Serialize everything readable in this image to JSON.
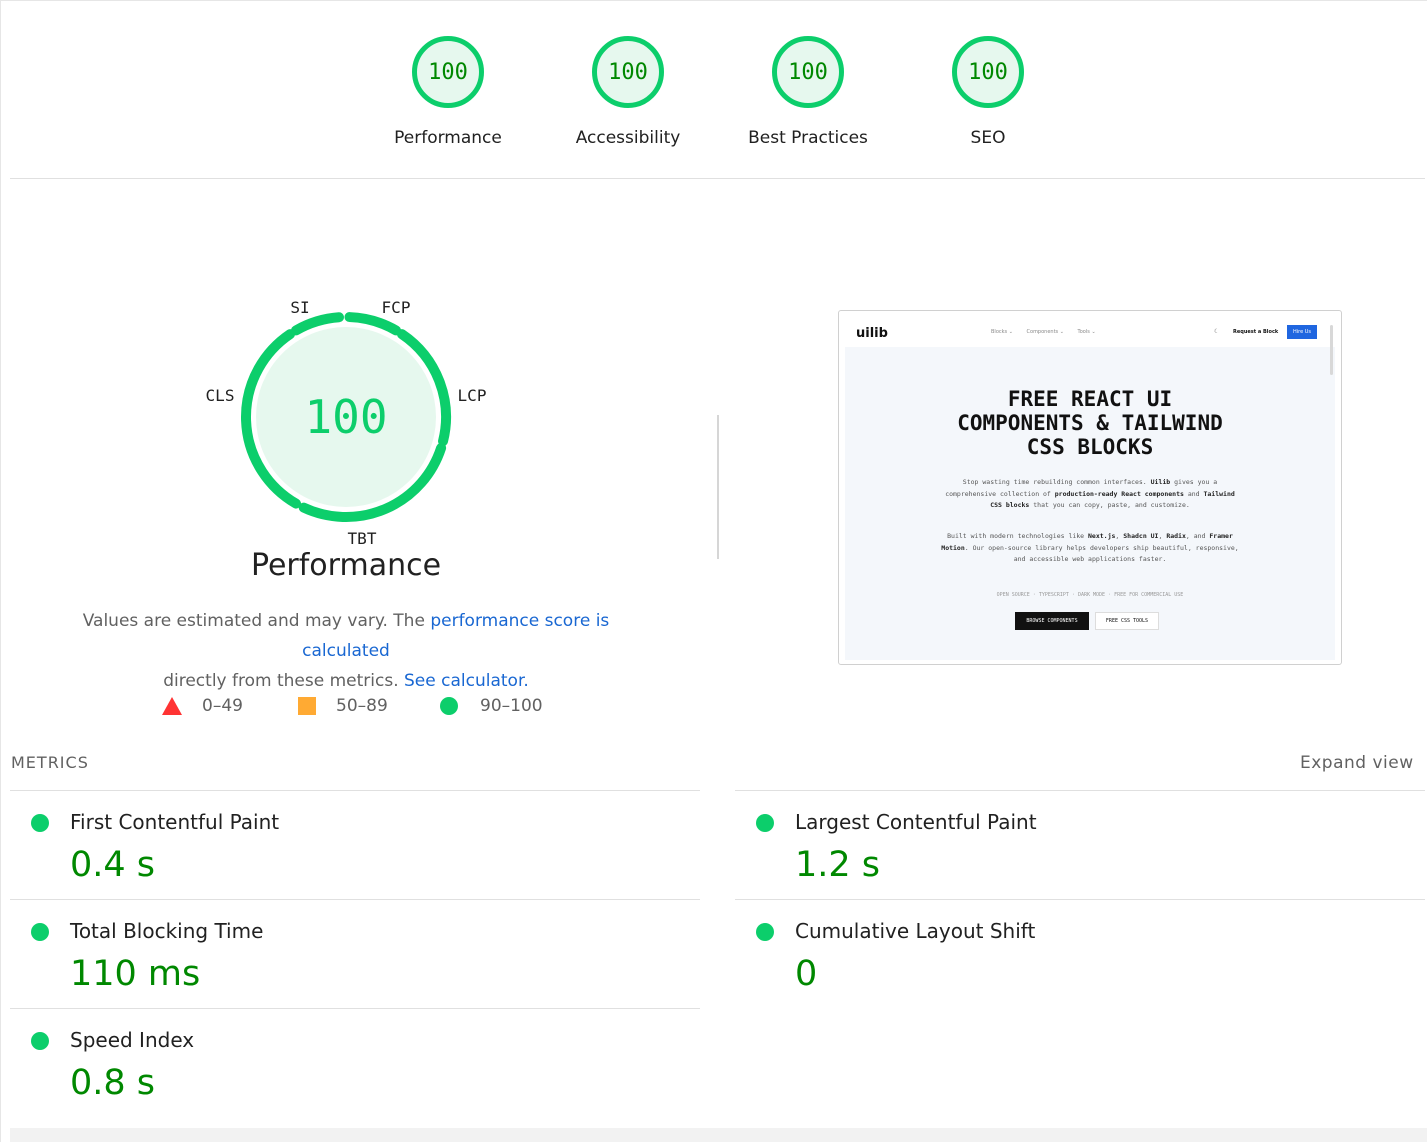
{
  "categories": [
    {
      "label": "Performance",
      "score": "100"
    },
    {
      "label": "Accessibility",
      "score": "100"
    },
    {
      "label": "Best Practices",
      "score": "100"
    },
    {
      "label": "SEO",
      "score": "100"
    }
  ],
  "gauge": {
    "score": "100",
    "title": "Performance",
    "labels": {
      "si": "SI",
      "fcp": "FCP",
      "lcp": "LCP",
      "tbt": "TBT",
      "cls": "CLS"
    },
    "description_prefix": "Values are estimated and may vary. The ",
    "description_link": "performance score is calculated",
    "description_suffix": "directly from these metrics.",
    "calculator_link": "See calculator.",
    "colors": {
      "pass": "#0cce6b",
      "pass_text": "#008800",
      "fill": "#e6f8ee"
    }
  },
  "legend": [
    {
      "range": "0–49",
      "shape": "triangle",
      "color": "#ff3333"
    },
    {
      "range": "50–89",
      "shape": "square",
      "color": "#ffaa33"
    },
    {
      "range": "90–100",
      "shape": "circle",
      "color": "#0cce6b"
    }
  ],
  "thumbnail": {
    "logo": "uilib",
    "nav": [
      "Blocks ⌄",
      "Components ⌄",
      "Tools ⌄"
    ],
    "theme_icon": "theme-toggle-icon",
    "request_button": "Request a Block",
    "hire_button": "Hire Us",
    "hero_lines": [
      "FREE REACT UI",
      "COMPONENTS & TAILWIND",
      "CSS BLOCKS"
    ],
    "para1": {
      "t1": "Stop wasting time rebuilding common interfaces. ",
      "b1": "Uilib",
      "t2": " gives you a comprehensive collection of ",
      "b2": "production-ready React components",
      "t3": " and ",
      "b3": "Tailwind CSS blocks",
      "t4": " that you can copy, paste, and customize."
    },
    "para2": {
      "t1": "Built with modern technologies like ",
      "b1": "Next.js",
      "t2": ", ",
      "b2": "Shadcn UI",
      "t3": ", ",
      "b3": "Radix",
      "t4": ", and ",
      "b4": "Framer Motion",
      "t5": ". Our open-source library helps developers ship beautiful, responsive, and accessible web applications faster."
    },
    "tags": "OPEN SOURCE · TYPESCRIPT · DARK MODE · FREE FOR COMMERCIAL USE",
    "cta_primary": "BROWSE COMPONENTS",
    "cta_secondary": "FREE CSS TOOLS"
  },
  "metrics_header": "METRICS",
  "expand_view": "Expand view",
  "metrics": [
    {
      "title": "First Contentful Paint",
      "value": "0.4 s"
    },
    {
      "title": "Largest Contentful Paint",
      "value": "1.2 s"
    },
    {
      "title": "Total Blocking Time",
      "value": "110 ms"
    },
    {
      "title": "Cumulative Layout Shift",
      "value": "0"
    },
    {
      "title": "Speed Index",
      "value": "0.8 s"
    }
  ]
}
